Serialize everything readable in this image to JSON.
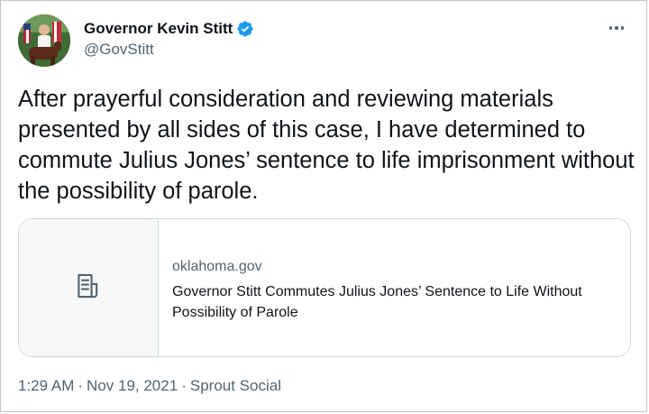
{
  "author": {
    "display_name": "Governor Kevin Stitt",
    "handle": "@GovStitt",
    "verified": true
  },
  "icons": {
    "verified": "verified-badge-icon",
    "more": "more-options-icon",
    "card_placeholder": "article-document-icon"
  },
  "tweet": {
    "text": "After prayerful consideration and reviewing materials presented by all sides of this case, I have determined to commute Julius Jones’ sentence to life imprisonment without the possibility of parole."
  },
  "link_card": {
    "domain": "oklahoma.gov",
    "title": "Governor Stitt Commutes Julius Jones’ Sentence to Life Without Possibility of Parole"
  },
  "meta": {
    "time": "1:29 AM",
    "date": "Nov 19, 2021",
    "source": "Sprout Social",
    "separator": "·"
  },
  "colors": {
    "text_primary": "#0f1419",
    "text_secondary": "#536471",
    "verified_blue": "#1d9bf0",
    "card_border": "#cfd9de",
    "card_media_bg": "#f7f9f9"
  }
}
